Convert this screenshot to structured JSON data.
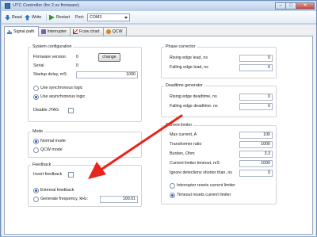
{
  "window": {
    "title": "UTC Controller (for 2.xx firmware)",
    "buttons": {
      "minimize": "–",
      "maximize": "□",
      "close": "✕"
    }
  },
  "toolbar": {
    "read_label": "Read",
    "write_label": "Write",
    "restart_label": "Restart",
    "port_label": "Port:",
    "port_value": "COM3"
  },
  "tabs": [
    {
      "label": "Signal path",
      "icon": "signal-icon",
      "active": true
    },
    {
      "label": "Interrupter",
      "icon": "interrupter-icon",
      "active": false
    },
    {
      "label": "Fcsw chart",
      "icon": "chart-icon",
      "active": false
    },
    {
      "label": "QCW",
      "icon": "qcw-icon",
      "active": false
    }
  ],
  "system_config": {
    "title": "System configuration",
    "firmware_label": "Firmware version:",
    "firmware_value": "0",
    "change_button": "change",
    "serial_label": "Serial",
    "serial_value": "0",
    "startup_delay_label": "Startup delay, mS:",
    "startup_delay_value": "1000",
    "sync_logic_label": "Use synchronous logic",
    "async_logic_label": "Use asynchronous logic",
    "disable_jtag_label": "Disable JTAG"
  },
  "mode": {
    "title": "Mode",
    "normal_label": "Normal mode",
    "qcw_label": "QCW mode"
  },
  "feedback": {
    "title": "Feedback",
    "invert_label": "Invert feedback",
    "external_label": "External feedback",
    "generate_label": "Generate frequency, kHz:",
    "generate_value": "100.01"
  },
  "phase_corrector": {
    "title": "Phase corrector",
    "rising_label": "Rising edge lead, ns",
    "rising_value": "0",
    "falling_label": "Falling edge lead, ns",
    "falling_value": "0"
  },
  "deadtime": {
    "title": "Deadtime generator",
    "rising_label": "Rising edge deadtime, ns",
    "rising_value": "0",
    "falling_label": "Falling edge deadtime, ns",
    "falling_value": "0"
  },
  "current_limiter": {
    "title": "Current limiter",
    "max_current_label": "Max current, A",
    "max_current_value": "100",
    "ratio_label": "Transformer ratio",
    "ratio_value": "1000",
    "burden_label": "Burden, Ohm",
    "burden_value": "3.3",
    "timeout_label": "Current limiter timeout, mS",
    "timeout_value": "1000",
    "ignore_label": "Ignore detections shorter than, ns",
    "ignore_value": "0",
    "interrupter_resets_label": "Interrupter resets current limiter",
    "timeout_resets_label": "Timeout resets current limiter"
  },
  "colors": {
    "annotation_arrow": "#e8241c",
    "radio_selected": "#2a5fb5",
    "title_bar": "#c9d9ef"
  }
}
